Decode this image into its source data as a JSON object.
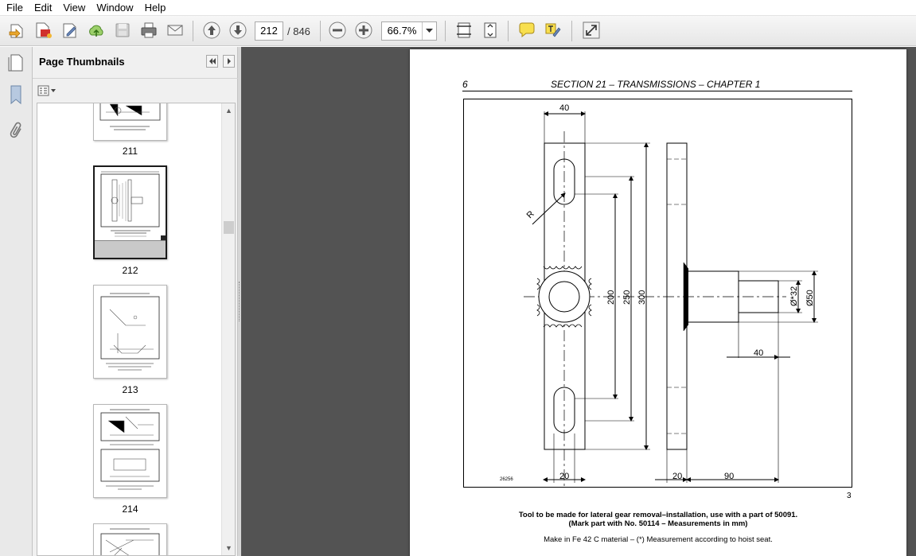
{
  "menu": [
    "File",
    "Edit",
    "View",
    "Window",
    "Help"
  ],
  "toolbar": {
    "current_page": "212",
    "total_pages": "/ 846",
    "zoom": "66.7%"
  },
  "panel": {
    "title": "Page Thumbnails",
    "thumbnails": [
      {
        "label": "211"
      },
      {
        "label": "212",
        "selected": true
      },
      {
        "label": "213"
      },
      {
        "label": "214"
      },
      {
        "label": ""
      }
    ]
  },
  "document": {
    "page_number": "6",
    "section": "SECTION 21 – TRANSMISSIONS – CHAPTER 1",
    "drawing": {
      "dim_top_width": "40",
      "dim_radius": "R",
      "dim_200": "200",
      "dim_250": "250",
      "dim_300": "300",
      "dim_bottom_left": "20",
      "dim_side_20": "20",
      "dim_side_90": "90",
      "dim_side_40": "40",
      "dim_dia_small": "Ø*32",
      "dim_dia_large": "Ø50",
      "ref_code": "26256"
    },
    "figure_number": "3",
    "caption_line1": "Tool to be made for lateral gear removal–installation, use with a part of 50091.",
    "caption_line2": "(Mark part with No. 50114 – Measurements in mm)",
    "caption_line3": "Make in Fe 42 C material – (*) Measurement according to hoist seat."
  },
  "colors": {
    "viewport_bg": "#535353",
    "panel_bg": "#f0f0f0",
    "toolbar_bg": "#ececec"
  }
}
